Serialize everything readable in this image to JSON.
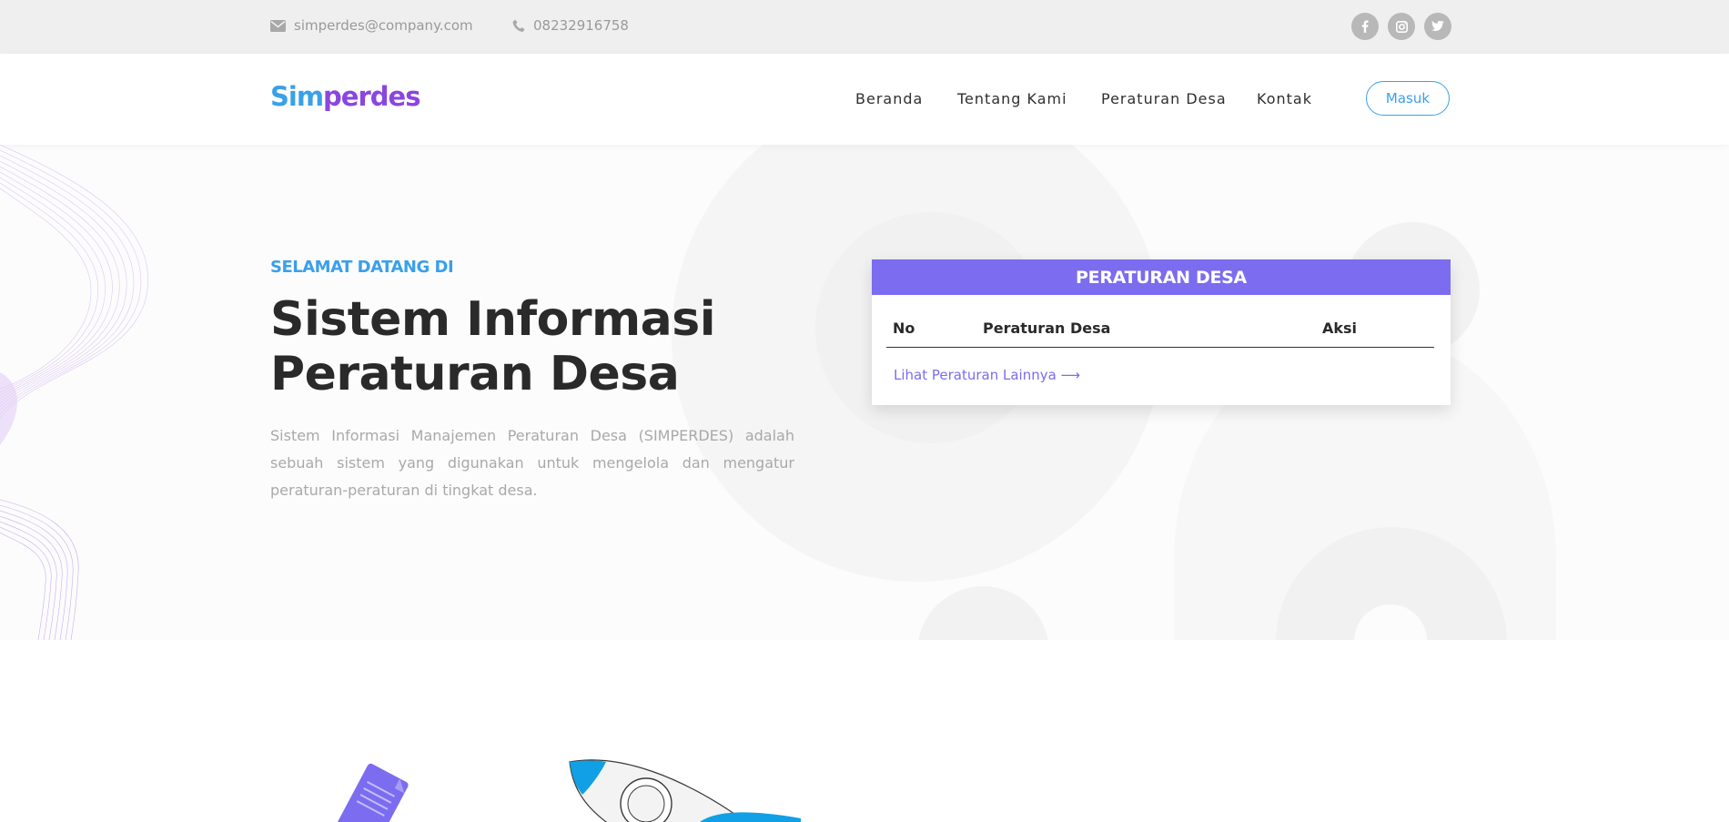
{
  "topbar": {
    "email": "simperdes@company.com",
    "phone": "08232916758",
    "socials": [
      "facebook-icon",
      "instagram-icon",
      "twitter-icon"
    ]
  },
  "brand": {
    "part1": "Sim",
    "part2": "perdes"
  },
  "nav": {
    "items": [
      "Beranda",
      "Tentang Kami",
      "Peraturan Desa",
      "Kontak"
    ],
    "login_label": "Masuk"
  },
  "hero": {
    "kicker": "SELAMAT DATANG DI",
    "title_line1": "Sistem Informasi",
    "title_line2": "Peraturan Desa",
    "description": "Sistem Informasi Manajemen Peraturan Desa (SIMPERDES) adalah sebuah sistem yang digunakan untuk mengelola dan mengatur peraturan-peraturan di tingkat desa."
  },
  "table": {
    "header": "PERATURAN DESA",
    "columns": [
      "No",
      "Peraturan Desa",
      "Aksi"
    ],
    "rows": [],
    "more_link": "Lihat Peraturan Lainnya ⟶"
  },
  "colors": {
    "accent_blue": "#3aa0ea",
    "accent_purple": "#7b6cf0",
    "logo_purple": "#8b45e0"
  }
}
